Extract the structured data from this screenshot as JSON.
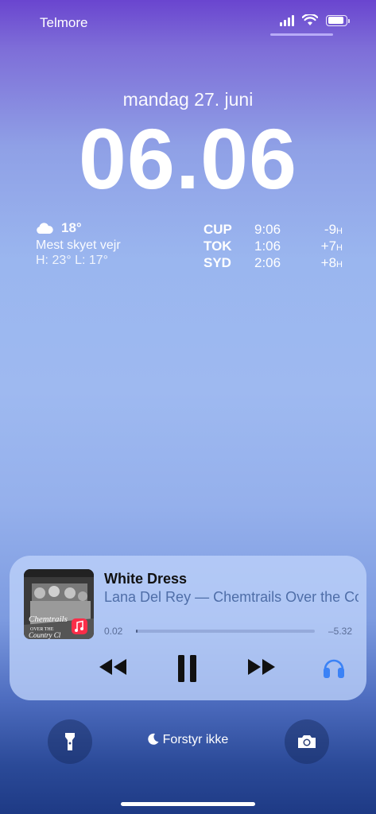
{
  "status_bar": {
    "carrier": "Telmore",
    "signal_bars": 4,
    "battery_level": 0.8
  },
  "lock_screen": {
    "date": "mandag 27. juni",
    "time": "06.06"
  },
  "weather": {
    "icon": "cloud-icon",
    "temperature": "18°",
    "condition": "Mest skyet vejr",
    "high_low": "H: 23° L: 17°"
  },
  "world_clock": [
    {
      "city": "CUP",
      "time": "9:06",
      "offset": "-9",
      "unit": "H"
    },
    {
      "city": "TOK",
      "time": "1:06",
      "offset": "+7",
      "unit": "H"
    },
    {
      "city": "SYD",
      "time": "2:06",
      "offset": "+8",
      "unit": "H"
    }
  ],
  "now_playing": {
    "title": "White Dress",
    "subtitle": "Lana Del Rey — Chemtrails Over the Country Club",
    "elapsed": "0.02",
    "remaining": "–5.32",
    "progress": 0.006,
    "album_cover_text": "CHEMTRAILS OVER THE COUNTRY CLUB",
    "controls": {
      "previous": "backward-icon",
      "pause": "pause-icon",
      "next": "forward-icon",
      "output": "airpods-max-icon"
    },
    "accent": "#3b82f6"
  },
  "bottom": {
    "flashlight": "flashlight-icon",
    "camera": "camera-icon",
    "focus_label": "Forstyr ikke",
    "focus_icon": "moon-icon"
  }
}
